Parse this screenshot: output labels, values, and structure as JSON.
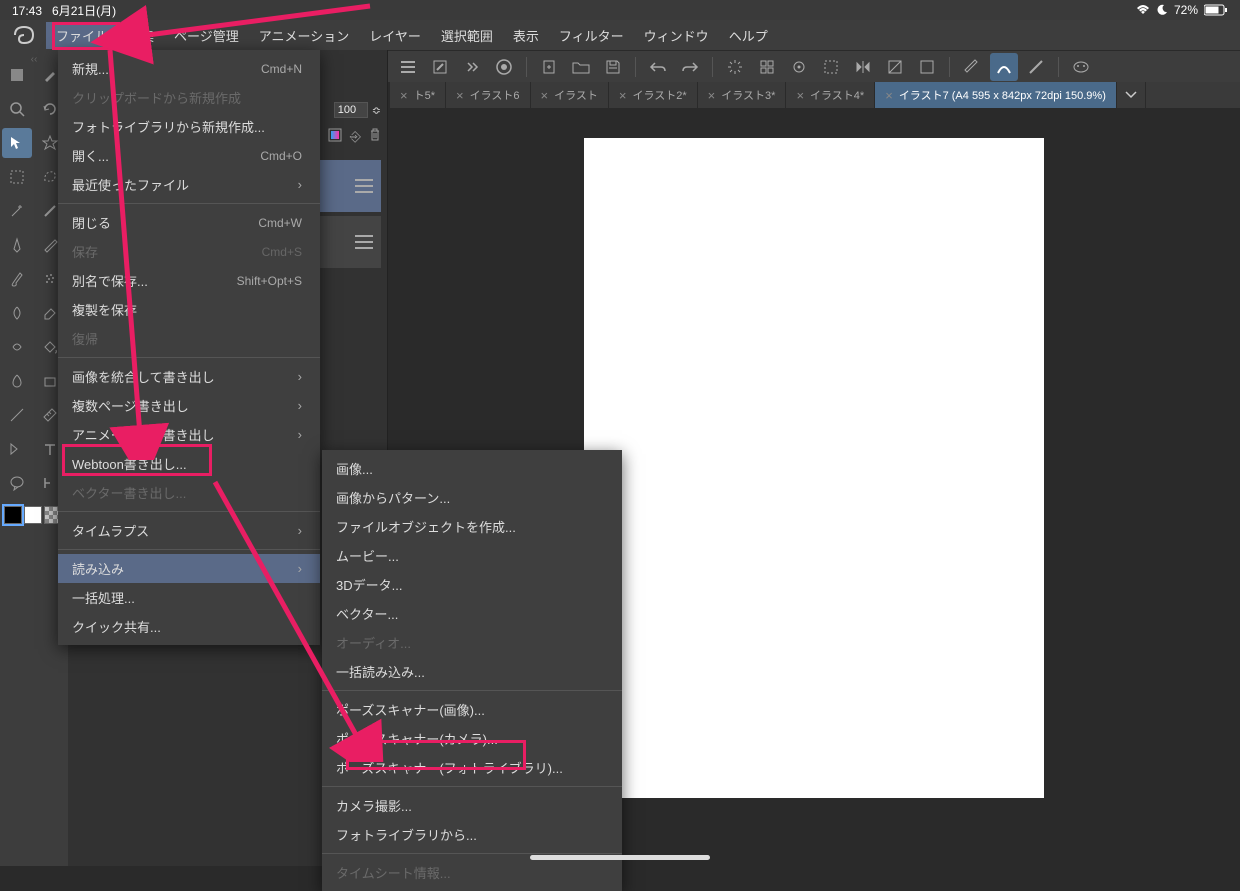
{
  "status": {
    "time": "17:43",
    "date": "6月21日(月)",
    "battery": "72%"
  },
  "menubar": {
    "items": [
      "ファイル",
      "編集",
      "ページ管理",
      "アニメーション",
      "レイヤー",
      "選択範囲",
      "表示",
      "フィルター",
      "ウィンドウ",
      "ヘルプ"
    ]
  },
  "toolbar": {
    "icons": [
      "menu",
      "edit-mode",
      "lasso",
      "color-wheel",
      "new-doc",
      "open-folder",
      "save",
      "undo",
      "redo",
      "loading",
      "grid",
      "snap",
      "crop",
      "flip",
      "gradient",
      "dropper",
      "pen",
      "curve",
      "line",
      "assist",
      "chat"
    ]
  },
  "tabs": [
    {
      "label": "ト5*",
      "dirty": true,
      "active": false
    },
    {
      "label": "イラスト6",
      "dirty": false,
      "active": false
    },
    {
      "label": "イラスト",
      "dirty": false,
      "active": false
    },
    {
      "label": "イラスト2*",
      "dirty": true,
      "active": false
    },
    {
      "label": "イラスト3*",
      "dirty": true,
      "active": false
    },
    {
      "label": "イラスト4*",
      "dirty": true,
      "active": false
    },
    {
      "label": "イラスト7 (A4 595 x 842px 72dpi 150.9%)",
      "dirty": false,
      "active": true
    }
  ],
  "side": {
    "opacity_value": "100",
    "opacity_symbol": "≎"
  },
  "file_menu": {
    "items": [
      {
        "label": "新規...",
        "shortcut": "Cmd+N"
      },
      {
        "label": "クリップボードから新規作成",
        "disabled": true
      },
      {
        "label": "フォトライブラリから新規作成..."
      },
      {
        "label": "開く...",
        "shortcut": "Cmd+O"
      },
      {
        "label": "最近使ったファイル",
        "submenu": true
      },
      {
        "sep": true
      },
      {
        "label": "閉じる",
        "shortcut": "Cmd+W"
      },
      {
        "label": "保存",
        "shortcut": "Cmd+S",
        "disabled": true
      },
      {
        "label": "別名で保存...",
        "shortcut": "Shift+Opt+S"
      },
      {
        "label": "複製を保存"
      },
      {
        "label": "復帰",
        "disabled": true
      },
      {
        "sep": true
      },
      {
        "label": "画像を統合して書き出し",
        "submenu": true
      },
      {
        "label": "複数ページ書き出し",
        "submenu": true
      },
      {
        "label": "アニメーション書き出し",
        "submenu": true
      },
      {
        "label": "Webtoon書き出し..."
      },
      {
        "label": "ベクター書き出し...",
        "disabled": true
      },
      {
        "sep": true
      },
      {
        "label": "タイムラプス",
        "submenu": true
      },
      {
        "sep": true
      },
      {
        "label": "読み込み",
        "submenu": true,
        "highlighted": true
      },
      {
        "label": "一括処理..."
      },
      {
        "label": "クイック共有..."
      }
    ]
  },
  "import_submenu": {
    "items": [
      {
        "label": "画像..."
      },
      {
        "label": "画像からパターン..."
      },
      {
        "label": "ファイルオブジェクトを作成..."
      },
      {
        "label": "ムービー..."
      },
      {
        "label": "3Dデータ..."
      },
      {
        "label": "ベクター..."
      },
      {
        "label": "オーディオ...",
        "disabled": true
      },
      {
        "label": "一括読み込み..."
      },
      {
        "sep": true
      },
      {
        "label": "ポーズスキャナー(画像)..."
      },
      {
        "label": "ポーズスキャナー(カメラ)..."
      },
      {
        "label": "ポーズスキャナー(フォトライブラリ)..."
      },
      {
        "sep": true
      },
      {
        "label": "カメラ撮影..."
      },
      {
        "label": "フォトライブラリから..."
      },
      {
        "sep": true
      },
      {
        "label": "タイムシート情報...",
        "disabled": true
      }
    ]
  },
  "tools_left": [
    "sub",
    "hand",
    "zoom",
    "rotate",
    "move",
    "transform",
    "marquee",
    "lasso-sel",
    "wand",
    "pen-tool",
    "pencil",
    "brush",
    "airbrush",
    "deco",
    "eraser",
    "blend",
    "bucket",
    "gradient-tool",
    "figure",
    "frame",
    "ruler",
    "text",
    "balloon",
    "line-tool"
  ],
  "colors": {
    "fg": "#000000",
    "bg": "#ffffff",
    "transparent": "checker"
  }
}
